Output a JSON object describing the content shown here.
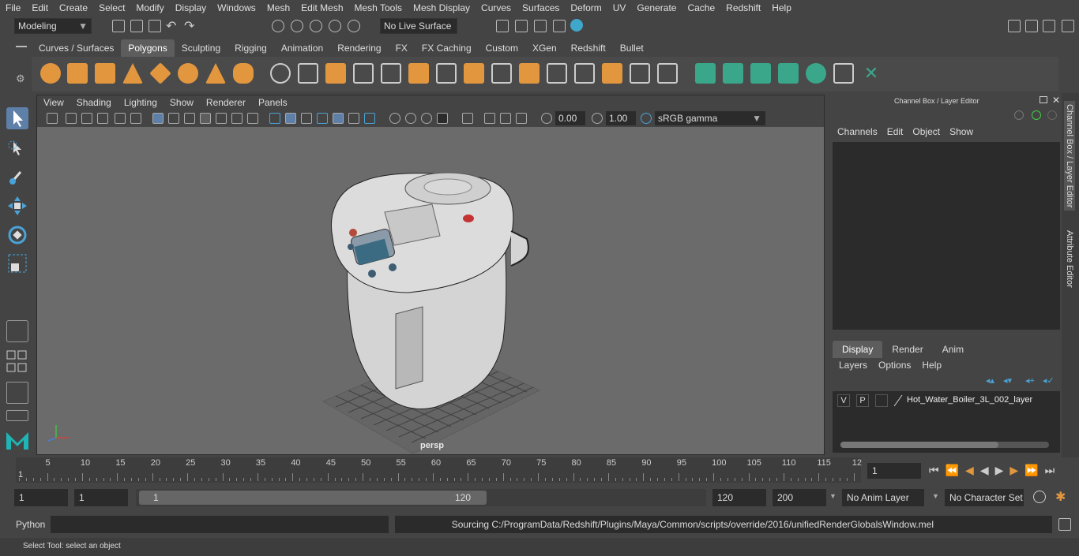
{
  "menu": [
    "File",
    "Edit",
    "Create",
    "Select",
    "Modify",
    "Display",
    "Windows",
    "Mesh",
    "Edit Mesh",
    "Mesh Tools",
    "Mesh Display",
    "Curves",
    "Surfaces",
    "Deform",
    "UV",
    "Generate",
    "Cache",
    "Redshift",
    "Help"
  ],
  "workspace": "Modeling",
  "live_surface": "No Live Surface",
  "shelf_tabs": [
    "Curves / Surfaces",
    "Polygons",
    "Sculpting",
    "Rigging",
    "Animation",
    "Rendering",
    "FX",
    "FX Caching",
    "Custom",
    "XGen",
    "Redshift",
    "Bullet"
  ],
  "active_shelf": "Polygons",
  "viewport": {
    "menu": [
      "View",
      "Shading",
      "Lighting",
      "Show",
      "Renderer",
      "Panels"
    ],
    "exposure": "0.00",
    "gamma": "1.00",
    "colorspace": "sRGB gamma",
    "camera": "persp"
  },
  "channel_box": {
    "title": "Channel Box / Layer Editor",
    "menu": [
      "Channels",
      "Edit",
      "Object",
      "Show"
    ],
    "tabs": [
      "Display",
      "Render",
      "Anim"
    ],
    "active_tab": "Display",
    "layer_menu": [
      "Layers",
      "Options",
      "Help"
    ],
    "layer": {
      "v": "V",
      "p": "P",
      "name": "Hot_Water_Boiler_3L_002_layer"
    }
  },
  "side_tabs": [
    "Channel Box / Layer Editor",
    "Attribute Editor"
  ],
  "timeline": {
    "ticks": [
      "5",
      "10",
      "15",
      "20",
      "25",
      "30",
      "35",
      "40",
      "45",
      "50",
      "55",
      "60",
      "65",
      "70",
      "75",
      "80",
      "85",
      "90",
      "95",
      "100",
      "105",
      "110",
      "115",
      "12"
    ],
    "start_label": "1",
    "current_frame": "1"
  },
  "range": {
    "start": "1",
    "start2": "1",
    "slider_start": "1",
    "slider_end": "120",
    "end": "120",
    "anim_end": "200",
    "anim_layer": "No Anim Layer",
    "char_set": "No Character Set"
  },
  "cmd": {
    "lang": "Python",
    "output": "Sourcing C:/ProgramData/Redshift/Plugins/Maya/Common/scripts/override/2016/unifiedRenderGlobalsWindow.mel"
  },
  "help": "Select Tool: select an object"
}
